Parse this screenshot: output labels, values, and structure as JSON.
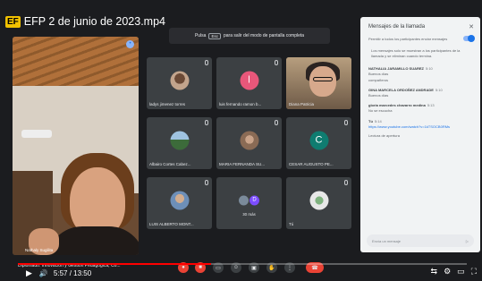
{
  "video": {
    "badge": "EF",
    "title": "EFP 2 de junio de 2023.mp4",
    "current_time": "5:57",
    "duration": "13:50",
    "progress_fraction": 0.43
  },
  "fullscreen_hint": {
    "prefix": "Pulsa",
    "key": "Esc",
    "suffix": "para salir del modo de pantalla completa"
  },
  "presenter": {
    "name": "Nathaly Sugilita"
  },
  "tiles": [
    {
      "name": "ladys jimenez torres",
      "avatar": "photo",
      "initial": ""
    },
    {
      "name": "luis fernando ramon b...",
      "avatar": "pink",
      "initial": "l"
    },
    {
      "name": "Diana Patricia",
      "avatar": "video",
      "initial": ""
    },
    {
      "name": "Albairo Cortes Cabez...",
      "avatar": "landscape",
      "initial": ""
    },
    {
      "name": "MARIA FERNANDA SU...",
      "avatar": "people",
      "initial": ""
    },
    {
      "name": "CESAR AUGUSTO PE...",
      "avatar": "green",
      "initial": "C"
    },
    {
      "name": "LUIS ALBERTO MONT...",
      "avatar": "man",
      "initial": ""
    },
    {
      "name": "30 más",
      "avatar": "more",
      "initial": "D"
    },
    {
      "name": "Tú",
      "avatar": "tu",
      "initial": ""
    }
  ],
  "chat": {
    "title": "Mensajes de la llamada",
    "toggle_label": "Permitir a todos los participantes enviar mensajes",
    "notice": "Los mensajes solo se muestran a los participantes de la llamada y se eliminan cuando termina.",
    "messages": [
      {
        "sender": "NATHALIA JARAMILLO SUAREZ",
        "time": "5:10",
        "text": "Buenos días",
        "link": ""
      },
      {
        "sender": "",
        "time": "",
        "text": "compañeros",
        "link": ""
      },
      {
        "sender": "GINA MARCELA ORDOÑEZ ANDRADE",
        "time": "5:10",
        "text": "Buenos días",
        "link": ""
      },
      {
        "sender": "gloria marcedes chavarro medina",
        "time": "5:13",
        "text": "No se escucha",
        "link": ""
      },
      {
        "sender": "Tú",
        "time": "5:14",
        "text": "",
        "link": "https://www.youtube.com/watch?v=1kTSOCB0RMs"
      },
      {
        "sender": "",
        "time": "",
        "text": "Lectura de apertura",
        "link": ""
      }
    ],
    "input_placeholder": "Envía un mensaje"
  },
  "meet_bar": {
    "call_title": "Diplomado: Innovación y Gestión Pedagógica, Co..."
  },
  "colors": {
    "accent": "#1a73e8",
    "danger": "#ea4335",
    "progress": "#ff0000"
  }
}
